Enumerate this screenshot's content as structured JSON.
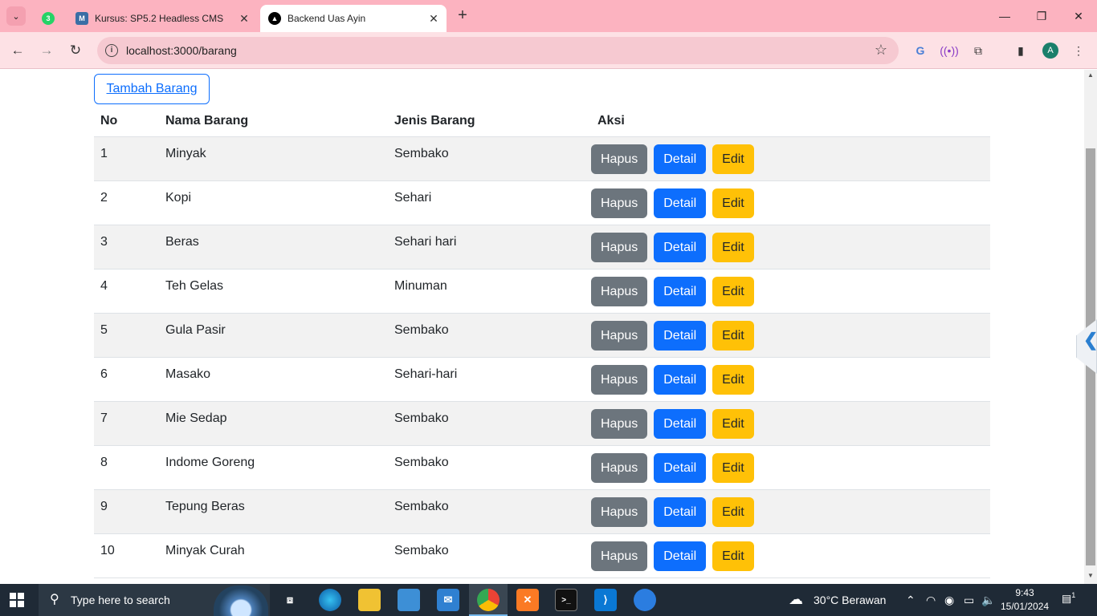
{
  "browser": {
    "tabs": [
      {
        "title": "",
        "badge": "3",
        "pinned": true
      },
      {
        "title": "Kursus: SP5.2 Headless CMS",
        "active": false
      },
      {
        "title": "Backend Uas Ayin",
        "active": true
      }
    ],
    "url": "localhost:3000/barang",
    "profile_initial": "A"
  },
  "page": {
    "add_button": "Tambah Barang",
    "table": {
      "headers": [
        "No",
        "Nama Barang",
        "Jenis Barang",
        "Aksi"
      ],
      "rows": [
        {
          "no": "1",
          "nama": "Minyak",
          "jenis": "Sembako"
        },
        {
          "no": "2",
          "nama": "Kopi",
          "jenis": "Sehari"
        },
        {
          "no": "3",
          "nama": "Beras",
          "jenis": "Sehari hari"
        },
        {
          "no": "4",
          "nama": "Teh Gelas",
          "jenis": "Minuman"
        },
        {
          "no": "5",
          "nama": "Gula Pasir",
          "jenis": "Sembako"
        },
        {
          "no": "6",
          "nama": "Masako",
          "jenis": "Sehari-hari"
        },
        {
          "no": "7",
          "nama": "Mie Sedap",
          "jenis": "Sembako"
        },
        {
          "no": "8",
          "nama": "Indome Goreng",
          "jenis": "Sembako"
        },
        {
          "no": "9",
          "nama": "Tepung Beras",
          "jenis": "Sembako"
        },
        {
          "no": "10",
          "nama": "Minyak Curah",
          "jenis": "Sembako"
        }
      ],
      "actions": {
        "delete": "Hapus",
        "detail": "Detail",
        "edit": "Edit"
      }
    }
  },
  "taskbar": {
    "search_placeholder": "Type here to search",
    "weather": "30°C  Berawan",
    "time": "9:43",
    "date": "15/01/2024",
    "notification_count": "1"
  },
  "colors": {
    "tabbar": "#fcb3c0",
    "toolbar": "#fde1e5",
    "primary": "#0d6efd",
    "secondary": "#6c757d",
    "warning": "#ffc107",
    "taskbar": "#1f2a36"
  }
}
